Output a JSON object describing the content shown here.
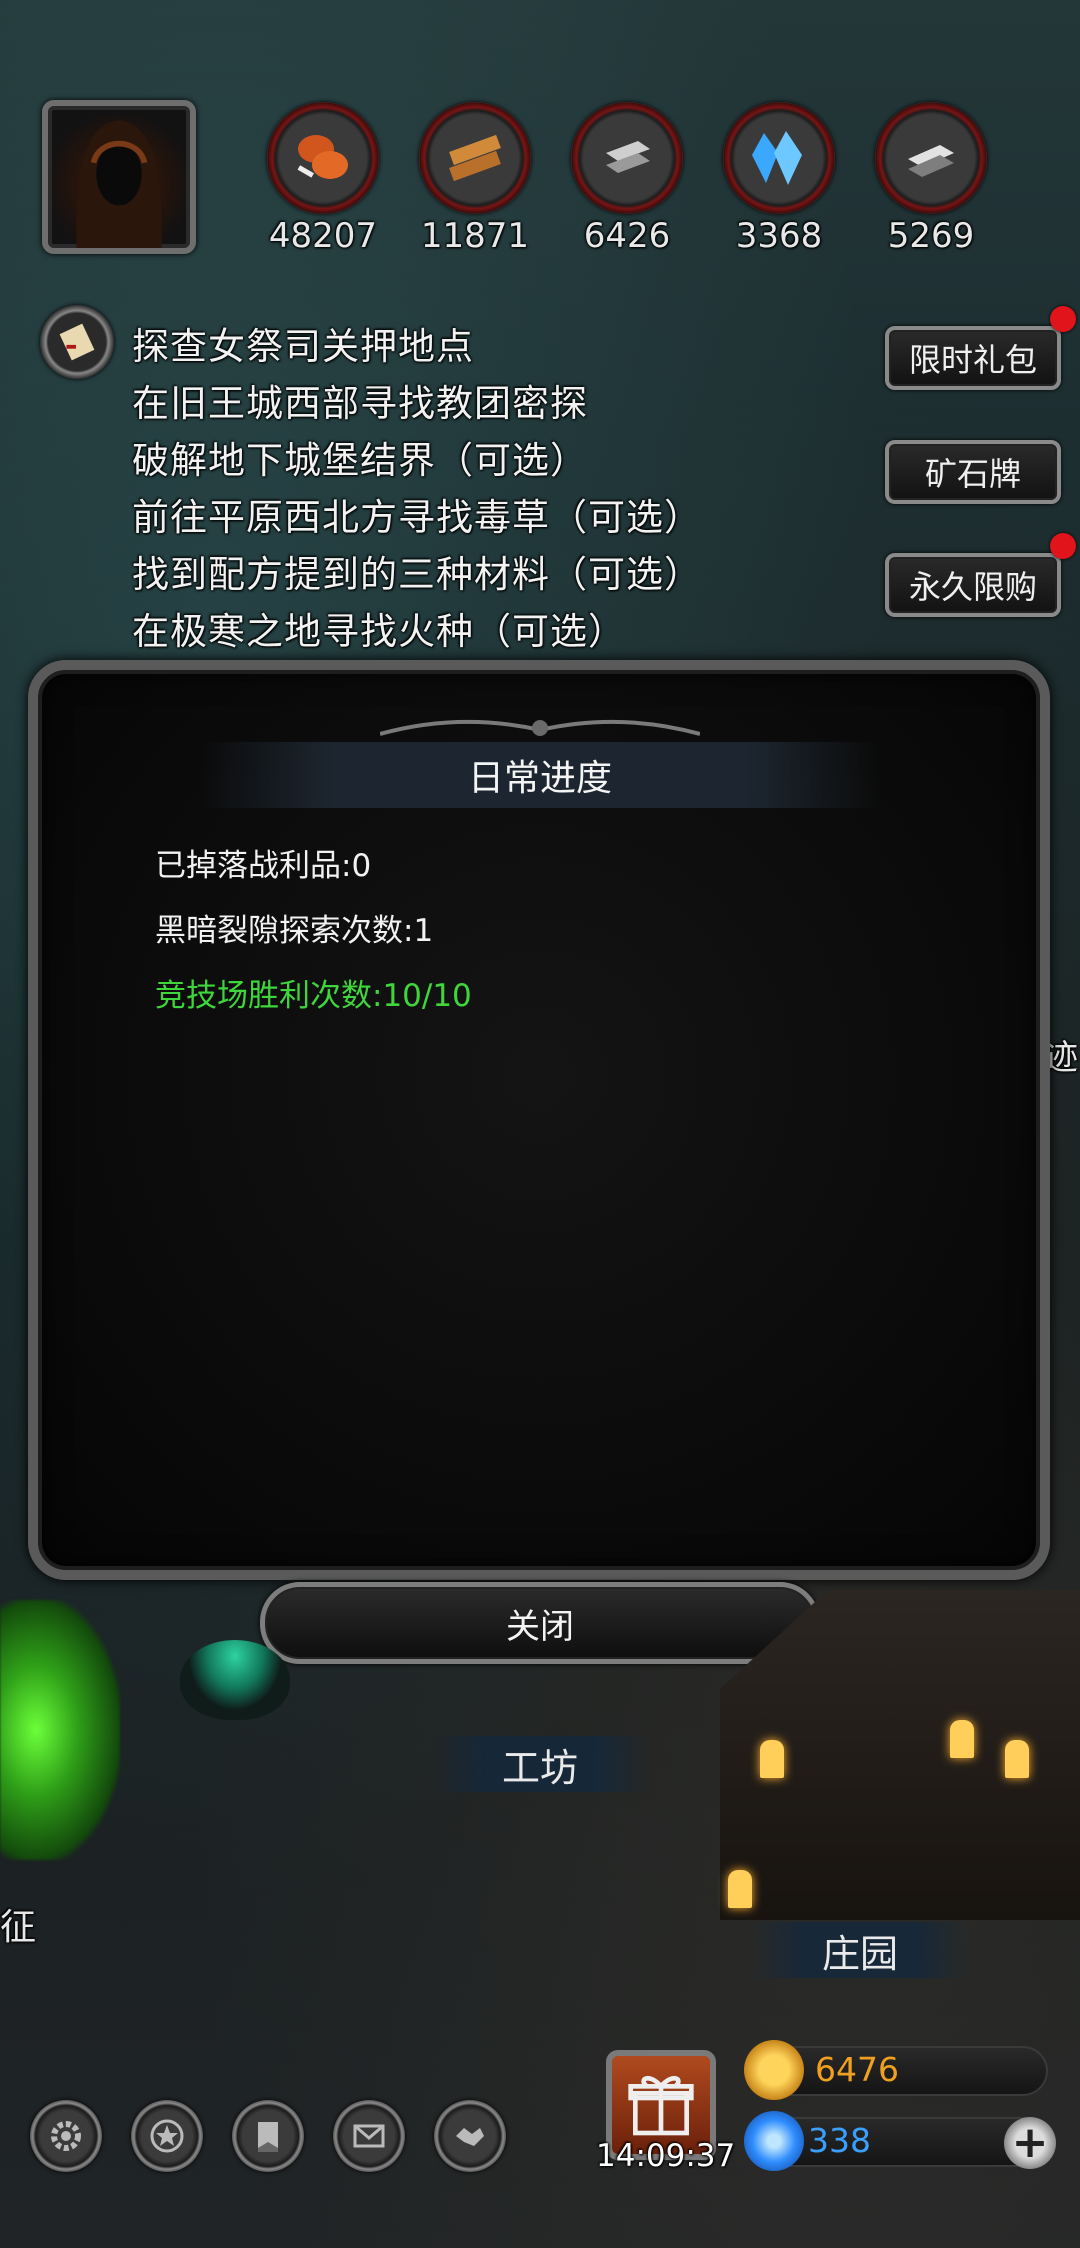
{
  "resources": [
    {
      "name": "meat-icon",
      "value": "48207"
    },
    {
      "name": "wood-icon",
      "value": "11871"
    },
    {
      "name": "iron-icon",
      "value": "6426"
    },
    {
      "name": "crystal-icon",
      "value": "3368"
    },
    {
      "name": "steel-icon",
      "value": "5269"
    }
  ],
  "quests": [
    "探查女祭司关押地点",
    "在旧王城西部寻找教团密探",
    "破解地下城堡结界（可选）",
    "前往平原西北方寻找毒草（可选）",
    "找到配方提到的三种材料（可选）",
    "在极寒之地寻找火种（可选）"
  ],
  "side_buttons": {
    "limited_gift": "限时礼包",
    "ore_card": "矿石牌",
    "permanent_limited": "永久限购"
  },
  "dialog": {
    "title": "日常进度",
    "lines": [
      "已掉落战利品:0",
      "黑暗裂隙探索次数:1",
      "竞技场胜利次数:10/10"
    ],
    "close_label": "关闭"
  },
  "map": {
    "right_edge_label": "迹",
    "workshop": "工坊",
    "left_edge_label": "征",
    "manor": "庄园"
  },
  "hud": {
    "clock": "14:09:37",
    "gold": "6476",
    "gems": "338",
    "plus": "+"
  },
  "colors": {
    "green_text": "#3ed63a",
    "gold_text": "#f0a020",
    "gem_text": "#3aa0ff",
    "red_dot": "#e0141a"
  }
}
